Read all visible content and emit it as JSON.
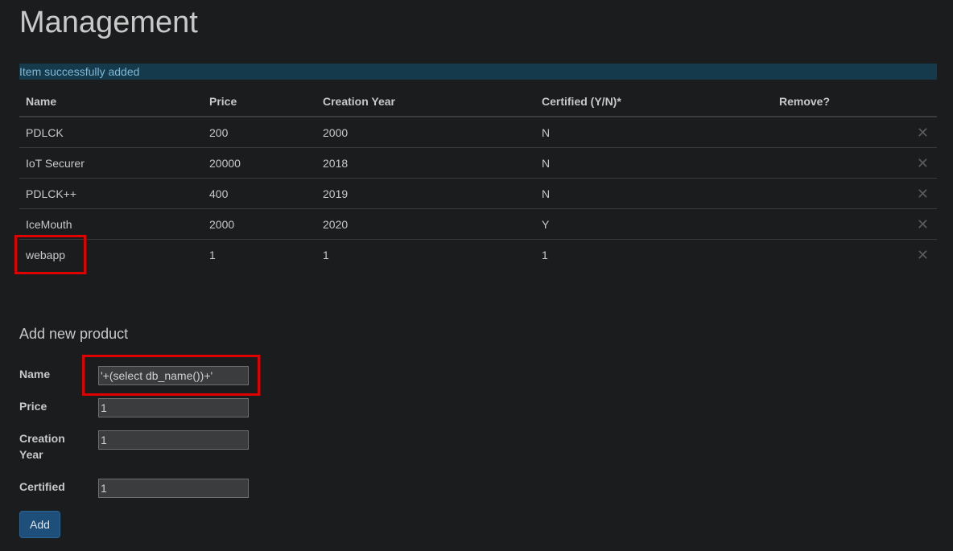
{
  "page": {
    "title": "Management"
  },
  "alert": {
    "message": "Item successfully added"
  },
  "table": {
    "headers": {
      "name": "Name",
      "price": "Price",
      "creation_year": "Creation Year",
      "certified": "Certified (Y/N)*",
      "remove": "Remove?"
    },
    "remove_glyph": "✕",
    "rows": [
      {
        "name": "PDLCK",
        "price": "200",
        "creation_year": "2000",
        "certified": "N"
      },
      {
        "name": "IoT Securer",
        "price": "20000",
        "creation_year": "2018",
        "certified": "N"
      },
      {
        "name": "PDLCK++",
        "price": "400",
        "creation_year": "2019",
        "certified": "N"
      },
      {
        "name": "IceMouth",
        "price": "2000",
        "creation_year": "2020",
        "certified": "Y"
      },
      {
        "name": "webapp",
        "price": "1",
        "creation_year": "1",
        "certified": "1"
      }
    ]
  },
  "form": {
    "title": "Add new product",
    "name_label": "Name",
    "name_value": "'+(select db_name())+'",
    "price_label": "Price",
    "price_value": "1",
    "creation_year_label": "Creation\nYear",
    "creation_year_value": "1",
    "certified_label": "Certified",
    "certified_value": "1",
    "add_label": "Add"
  },
  "colors": {
    "background": "#1b1c1e",
    "alert_background": "#143a4c",
    "alert_text": "#7fb7d6",
    "highlight": "#e00000",
    "button": "#1d4f7a"
  }
}
